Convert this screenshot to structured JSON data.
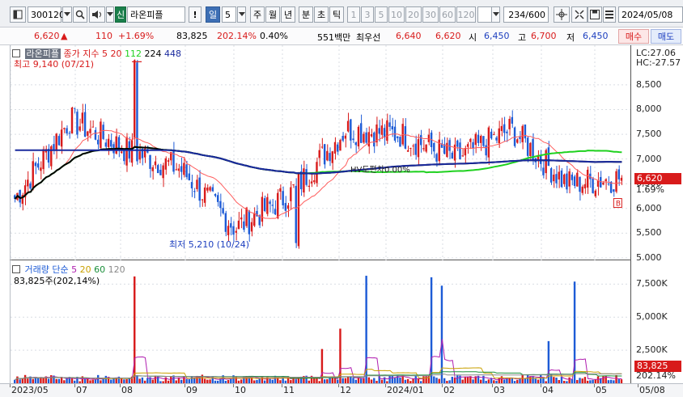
{
  "colors": {
    "up": "#d81b1b",
    "down": "#1d5bd6",
    "ma5": "#d81b1b",
    "ma20": "#ff5c5c",
    "ma112": "#1fd11f",
    "ma224": "#000000",
    "ma448": "#1a2a9e"
  },
  "toolbar": {
    "code": "300120",
    "search_icon": "search-icon",
    "sound_icon": "speaker-icon",
    "market_tag": "신",
    "name": "라온피플",
    "alert": "!",
    "period_day": "일",
    "period_day_value": "5",
    "periods": [
      "주",
      "월",
      "년",
      "분",
      "초",
      "틱"
    ],
    "ticks": [
      "1",
      "3",
      "5",
      "10",
      "20",
      "30",
      "60",
      "120"
    ],
    "count": "234/600",
    "date": "2024/05/08"
  },
  "quote": {
    "price": "6,620",
    "arrow": "▲",
    "change": "110",
    "rate": "+1.69%",
    "volume": "83,825",
    "vol_rate": "202.14%",
    "turnover": "0.40%",
    "amount": "551백만",
    "ask_label": "최우선",
    "ask": "6,640",
    "bid": "6,620",
    "open_label": "시",
    "open": "6,450",
    "high_label": "고",
    "high": "6,700",
    "low_label": "저",
    "low": "6,450",
    "buy_btn": "매수",
    "sell_btn": "매도"
  },
  "price_legend": {
    "name": "라온피플",
    "title": "종가 지수 5",
    "ma": [
      "20",
      "112",
      "224",
      "448"
    ],
    "high_note": "최고 9,140 (07/21)",
    "low_note": "최저 5,210 (10/24)",
    "mid_note": "HV도편차0.00%"
  },
  "vol_legend": {
    "title": "거래량 단순",
    "ma": [
      "5",
      "20",
      "60",
      "120"
    ],
    "value": "83,825주(202,14%)"
  },
  "price_axis": {
    "lc": "LC:27.06",
    "hc": "HC:-27.57",
    "ticks": [
      "8,500",
      "8,000",
      "7,500",
      "7,000",
      "6,500",
      "6,000",
      "5,500",
      "5,000"
    ],
    "last": "6,620",
    "last_rate": "1.69%",
    "b_mark": "B"
  },
  "vol_axis": {
    "ticks": [
      "7,500K",
      "5,000K",
      "2,500K"
    ],
    "last": "83,825",
    "last_rate": "202.14%"
  },
  "x_axis": [
    "2023/05",
    "07",
    "08",
    "09",
    "10",
    "11",
    "12",
    "2024/01",
    "02",
    "03",
    "04",
    "05",
    "05/08"
  ],
  "chart_data": {
    "type": "candlestick",
    "title": "라온피플",
    "price_range": [
      4950,
      9300
    ],
    "volume_range": [
      0,
      9300
    ],
    "max_point": {
      "value": 9140,
      "date": "07/21"
    },
    "min_point": {
      "value": 5210,
      "date": "10/24"
    },
    "monthly_close_estimates": [
      {
        "month": "2023/05",
        "close": 6200
      },
      {
        "month": "07",
        "close": 7800
      },
      {
        "month": "08",
        "close": 7200
      },
      {
        "month": "09",
        "close": 6800
      },
      {
        "month": "10",
        "close": 5600
      },
      {
        "month": "11",
        "close": 6300
      },
      {
        "month": "12",
        "close": 7600
      },
      {
        "month": "2024/01",
        "close": 7500
      },
      {
        "month": "02",
        "close": 7000
      },
      {
        "month": "03",
        "close": 7600
      },
      {
        "month": "04",
        "close": 6500
      },
      {
        "month": "05",
        "close": 6620
      }
    ]
  }
}
